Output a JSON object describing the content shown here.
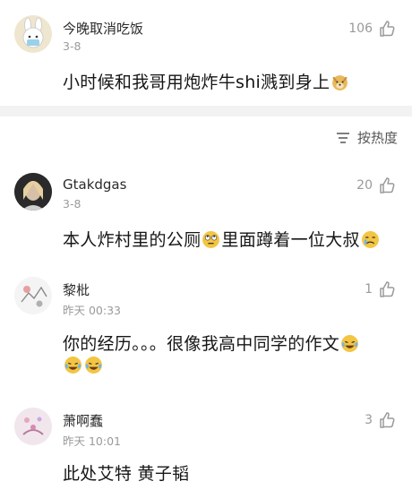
{
  "comments": [
    {
      "username": "今晚取消吃饭",
      "time": "3-8",
      "likes": "106",
      "text": "小时候和我哥用炮炸牛shi溅到身上",
      "emoji_after": [
        "doge-emoji"
      ]
    },
    {
      "username": "Gtakdgas",
      "time": "3-8",
      "likes": "20",
      "text_a": "本人炸村里的公厕",
      "text_b": "里面蹲着一位大叔",
      "emoji_mid": "rolling-eyes-emoji",
      "emoji_end": "crying-emoji"
    },
    {
      "username": "黎枇",
      "time": "昨天 00:33",
      "likes": "1",
      "text": "你的经历。。。很像我高中同学的作文",
      "emoji_after": [
        "laughing-crying-emoji"
      ],
      "line2_emojis": [
        "laughing-crying-emoji",
        "laughing-crying-emoji"
      ]
    },
    {
      "username": "萧啊蠢",
      "time": "昨天 10:01",
      "likes": "3",
      "text": "此处艾特 黄子韬"
    }
  ],
  "sort": {
    "label": "按热度",
    "icon": "sort-icon"
  },
  "colors": {
    "meta": "#9a9a9a",
    "separator": "#f2f2f2",
    "text": "#161616"
  }
}
